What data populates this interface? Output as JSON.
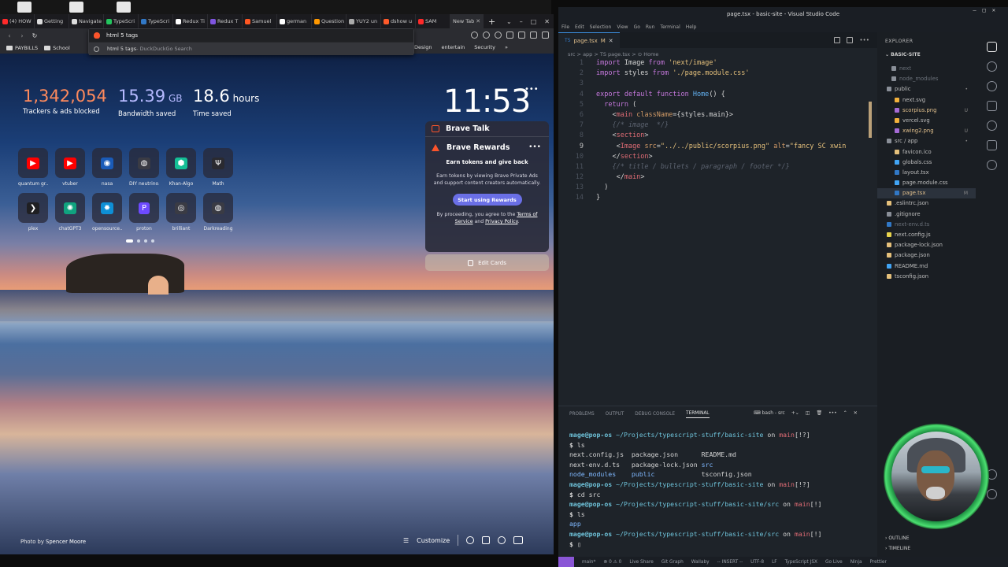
{
  "brave": {
    "tabs": [
      {
        "label": "(4) HOW",
        "color": "#ff2a2a"
      },
      {
        "label": "Getting",
        "color": "#dcdcdc"
      },
      {
        "label": "Navigate",
        "color": "#dcdcdc"
      },
      {
        "label": "TypeScri",
        "color": "#23c55e"
      },
      {
        "label": "TypeScri",
        "color": "#3178c6"
      },
      {
        "label": "Redux Ti",
        "color": "#ffffff"
      },
      {
        "label": "Redux T",
        "color": "#7f55e0"
      },
      {
        "label": "Samuel",
        "color": "#ff5722"
      },
      {
        "label": "german",
        "color": "#ffffff"
      },
      {
        "label": "Question",
        "color": "#ff9800"
      },
      {
        "label": "YUY2 un",
        "color": "#aaaaaa"
      },
      {
        "label": "dshow u",
        "color": "#ff5a2a"
      },
      {
        "label": "SAM",
        "color": "#ff2a2a"
      }
    ],
    "active_tab": "New Tab",
    "omnibox_text": "html 5 tags",
    "omnibox_suggestion": "html 5 tags",
    "omnibox_engine": " - DuckDuckGo Search",
    "bookmarks": [
      "PAYBILLS",
      "School"
    ],
    "bookmarks_right": [
      "Design",
      "entertain",
      "Security"
    ],
    "stats": [
      {
        "value": "1,342,054",
        "unit": "",
        "label": "Trackers & ads blocked",
        "color": "#ff8a5c"
      },
      {
        "value": "15.39",
        "unit": " GB",
        "label": "Bandwidth saved",
        "color": "#b5b9ff"
      },
      {
        "value": "18.6",
        "unit": " hours",
        "label": "Time saved",
        "color": "#ffffff"
      }
    ],
    "clock": "11:53",
    "sites_row1": [
      {
        "label": "quantum gr...",
        "icon": "youtube-icon"
      },
      {
        "label": "vtuber",
        "icon": "youtube-icon"
      },
      {
        "label": "nasa",
        "icon": "noaa-icon"
      },
      {
        "label": "DIY neutrino...",
        "icon": "globe-icon"
      },
      {
        "label": "Khan-Algo",
        "icon": "khan-icon"
      },
      {
        "label": "Math",
        "icon": "trident-icon"
      }
    ],
    "sites_row2": [
      {
        "label": "plex",
        "icon": "plex-icon"
      },
      {
        "label": "chatGPT3",
        "icon": "openai-icon"
      },
      {
        "label": "opensource...",
        "icon": "gear-icon"
      },
      {
        "label": "proton",
        "icon": "proton-icon"
      },
      {
        "label": "brilliant",
        "icon": "brilliant-icon"
      },
      {
        "label": "Darkreading",
        "icon": "globe-icon"
      }
    ],
    "talk_title": "Brave Talk",
    "rewards_title": "Brave Rewards",
    "rewards_headline": "Earn tokens and give back",
    "rewards_body": "Earn tokens by viewing Brave Private Ads and support content creators automatically.",
    "rewards_button": "Start using Rewards",
    "rewards_terms_prefix": "By proceeding, you agree to the ",
    "rewards_terms_link": "Terms of Service",
    "rewards_terms_and": " and ",
    "rewards_privacy_link": "Privacy Policy",
    "rewards_terms_end": ".",
    "edit_cards": "Edit Cards",
    "photo_credit_prefix": "Photo by ",
    "photo_credit_name": "Spencer Moore",
    "customize": "Customize"
  },
  "vscode": {
    "title": "page.tsx - basic-site - Visual Studio Code",
    "menu": [
      "File",
      "Edit",
      "Selection",
      "View",
      "Go",
      "Run",
      "Terminal",
      "Help"
    ],
    "tab_label": "page.tsx",
    "tab_badge": "M",
    "breadcrumb": "src > app > TS page.tsx > ⊙ Home",
    "line_numbers": [
      "1",
      "2",
      "3",
      "4",
      "5",
      "6",
      "7",
      "8",
      "9",
      "10",
      "11",
      "12",
      "13",
      "14"
    ],
    "current_line": "9",
    "explorer_title": "EXPLORER",
    "project": "BASIC-SITE",
    "files": [
      {
        "name": "next",
        "indent": 18,
        "cls": "dim",
        "badge": ""
      },
      {
        "name": "node_modules",
        "indent": 18,
        "cls": "dim",
        "badge": ""
      },
      {
        "name": "public",
        "indent": 12,
        "cls": "",
        "badge": "•"
      },
      {
        "name": "next.svg",
        "indent": 22,
        "cls": "",
        "badge": ""
      },
      {
        "name": "scorpius.png",
        "indent": 22,
        "cls": "mod",
        "badge": "U"
      },
      {
        "name": "vercel.svg",
        "indent": 22,
        "cls": "",
        "badge": ""
      },
      {
        "name": "xwing2.png",
        "indent": 22,
        "cls": "mod",
        "badge": "U"
      },
      {
        "name": "src / app",
        "indent": 12,
        "cls": "",
        "badge": "•"
      },
      {
        "name": "favicon.ico",
        "indent": 22,
        "cls": "",
        "badge": ""
      },
      {
        "name": "globals.css",
        "indent": 22,
        "cls": "",
        "badge": ""
      },
      {
        "name": "layout.tsx",
        "indent": 22,
        "cls": "",
        "badge": ""
      },
      {
        "name": "page.module.css",
        "indent": 22,
        "cls": "",
        "badge": ""
      },
      {
        "name": "page.tsx",
        "indent": 22,
        "cls": "sel mod",
        "badge": "M"
      },
      {
        "name": ".eslintrc.json",
        "indent": 12,
        "cls": "",
        "badge": ""
      },
      {
        "name": ".gitignore",
        "indent": 12,
        "cls": "",
        "badge": ""
      },
      {
        "name": "next-env.d.ts",
        "indent": 12,
        "cls": "dim",
        "badge": ""
      },
      {
        "name": "next.config.js",
        "indent": 12,
        "cls": "",
        "badge": ""
      },
      {
        "name": "package-lock.json",
        "indent": 12,
        "cls": "",
        "badge": ""
      },
      {
        "name": "package.json",
        "indent": 12,
        "cls": "",
        "badge": ""
      },
      {
        "name": "README.md",
        "indent": 12,
        "cls": "",
        "badge": ""
      },
      {
        "name": "tsconfig.json",
        "indent": 12,
        "cls": "",
        "badge": ""
      }
    ],
    "outline": "OUTLINE",
    "timeline": "TIMELINE",
    "panel_tabs": [
      "PROBLEMS",
      "OUTPUT",
      "DEBUG CONSOLE",
      "TERMINAL"
    ],
    "terminal_name": "bash - src",
    "status_items": [
      "main*",
      "⊗ 0 ⚠ 0",
      "Live Share",
      "Git Graph",
      "Wallaby",
      "-- INSERT --",
      "UTF-8",
      "LF",
      "TypeScript JSX",
      "Go Live",
      "Ninja",
      "Prettier"
    ]
  }
}
